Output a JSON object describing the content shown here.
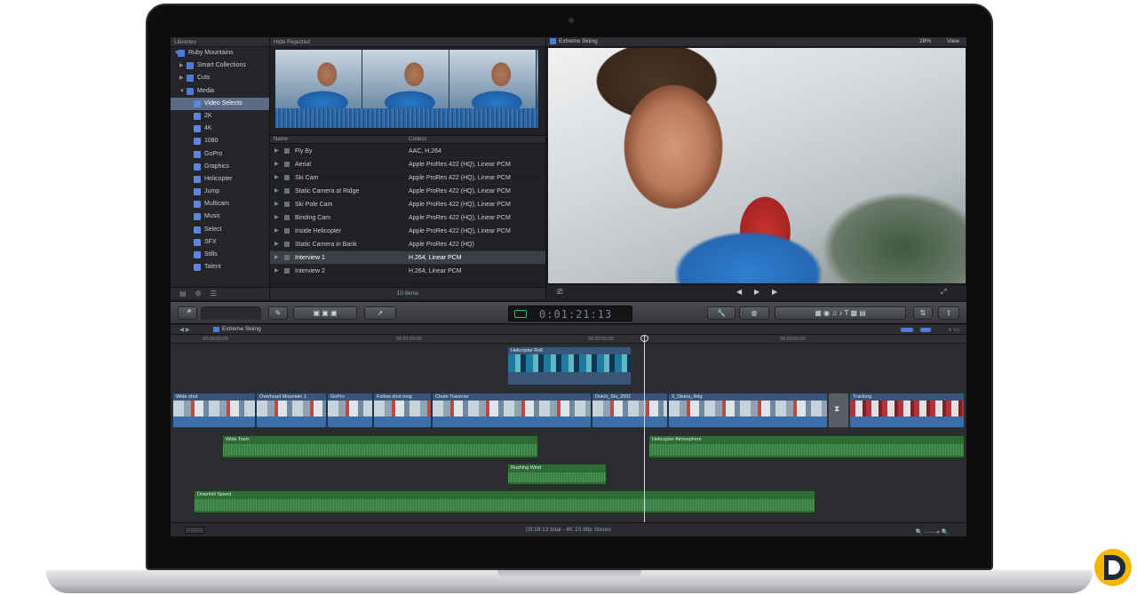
{
  "libraries": {
    "header": "Libraries",
    "items": [
      {
        "label": "Ruby Mountains"
      },
      {
        "label": "Smart Collections"
      },
      {
        "label": "Cuts"
      },
      {
        "label": "Media"
      },
      {
        "label": "Video Selects"
      },
      {
        "label": "2K"
      },
      {
        "label": "4K"
      },
      {
        "label": "1080"
      },
      {
        "label": "GoPro"
      },
      {
        "label": "Graphics"
      },
      {
        "label": "Helicopter"
      },
      {
        "label": "Jump"
      },
      {
        "label": "Multicam"
      },
      {
        "label": "Music"
      },
      {
        "label": "Select"
      },
      {
        "label": "SFX"
      },
      {
        "label": "Stills"
      },
      {
        "label": "Talent"
      }
    ]
  },
  "browser": {
    "header": "Hide Rejected",
    "columns": {
      "name": "Name",
      "codecs": "Codecs"
    },
    "rows": [
      {
        "name": "Fly By",
        "codecs": "AAC, H.264"
      },
      {
        "name": "Aerial",
        "codecs": "Apple ProRes 422 (HQ), Linear PCM"
      },
      {
        "name": "Ski Cam",
        "codecs": "Apple ProRes 422 (HQ), Linear PCM"
      },
      {
        "name": "Static Camera at Ridge",
        "codecs": "Apple ProRes 422 (HQ), Linear PCM"
      },
      {
        "name": "Ski Pole Cam",
        "codecs": "Apple ProRes 422 (HQ), Linear PCM"
      },
      {
        "name": "Binding Cam",
        "codecs": "Apple ProRes 422 (HQ), Linear PCM"
      },
      {
        "name": "Inside Helicopter",
        "codecs": "Apple ProRes 422 (HQ), Linear PCM"
      },
      {
        "name": "Static Camera in Bank",
        "codecs": "Apple ProRes 422 (HQ)"
      },
      {
        "name": "Interview 1",
        "codecs": "H.264, Linear PCM"
      },
      {
        "name": "Interview 2",
        "codecs": "H.264, Linear PCM"
      }
    ],
    "footer": "10 items"
  },
  "viewer": {
    "title": "Extreme Skiing",
    "zoom": "28%",
    "view_menu": "View"
  },
  "toolbar": {
    "timecode": "0:01:21:13"
  },
  "timeline": {
    "title": "Extreme Skiing",
    "ruler": [
      "00:00:00:00",
      "00:01:00:00",
      "00:02:00:00",
      "00:03:00:00"
    ],
    "connected_video": {
      "label": "Helicopter Roll"
    },
    "primary_clips": [
      {
        "label": "Wide shot"
      },
      {
        "label": "Overhead Mountain 1"
      },
      {
        "label": "GoPro"
      },
      {
        "label": "Follow shot long"
      },
      {
        "label": "Chute Traverse"
      },
      {
        "label": "Dutch_Ski_2001"
      },
      {
        "label": "3_Skiers_Rdg"
      },
      {
        "label": ""
      },
      {
        "label": "Tracking"
      }
    ],
    "audio_clips": [
      {
        "label": "Wide Town"
      },
      {
        "label": "Helicopter Atmosphere"
      },
      {
        "label": "Rushing Wind"
      },
      {
        "label": "Downhill Speed"
      }
    ],
    "status": "03:18:13 total - 4K 23.98p Stereo"
  }
}
